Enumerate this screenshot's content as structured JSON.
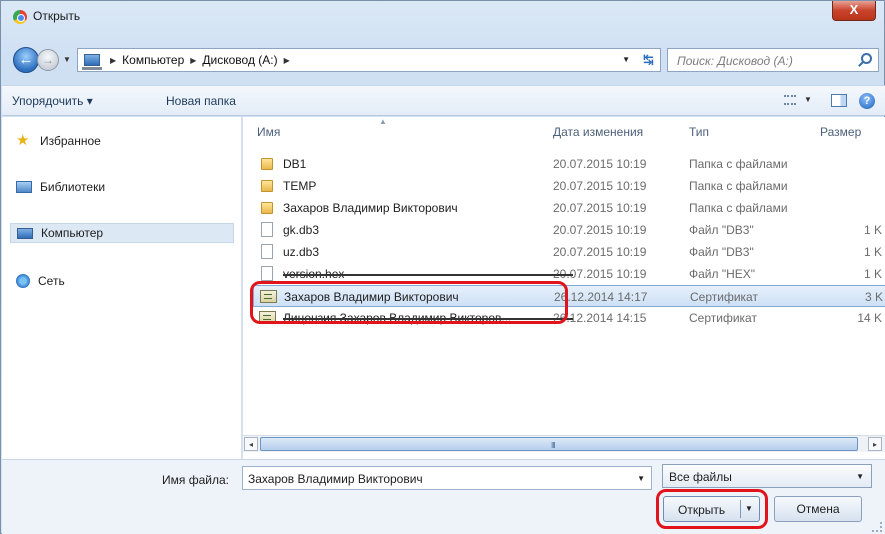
{
  "window": {
    "title": "Открыть",
    "close_glyph": "X"
  },
  "nav": {
    "back_glyph": "←",
    "forward_glyph": "→",
    "breadcrumbs": [
      "Компьютер",
      "Дисковод (A:)"
    ],
    "search_placeholder": "Поиск: Дисковод (A:)"
  },
  "toolbar": {
    "organize": "Упорядочить ▾",
    "new_folder": "Новая папка"
  },
  "sidebar": {
    "items": [
      {
        "label": "Избранное",
        "icon": "star-icon"
      },
      {
        "label": "Библиотеки",
        "icon": "library-icon"
      },
      {
        "label": "Компьютер",
        "icon": "computer-icon",
        "selected": true
      },
      {
        "label": "Сеть",
        "icon": "network-icon"
      }
    ]
  },
  "columns": {
    "name": "Имя",
    "date": "Дата изменения",
    "type": "Тип",
    "size": "Размер"
  },
  "files": [
    {
      "name": "DB1",
      "date": "20.07.2015 10:19",
      "type": "Папка с файлами",
      "size": "",
      "kind": "folder"
    },
    {
      "name": "TEMP",
      "date": "20.07.2015 10:19",
      "type": "Папка с файлами",
      "size": "",
      "kind": "folder"
    },
    {
      "name": "Захаров Владимир Викторович",
      "date": "20.07.2015 10:19",
      "type": "Папка с файлами",
      "size": "",
      "kind": "folder"
    },
    {
      "name": "gk.db3",
      "date": "20.07.2015 10:19",
      "type": "Файл \"DB3\"",
      "size": "1 K",
      "kind": "file"
    },
    {
      "name": "uz.db3",
      "date": "20.07.2015 10:19",
      "type": "Файл \"DB3\"",
      "size": "1 K",
      "kind": "file"
    },
    {
      "name": "version.hex",
      "date": "20.07.2015 10:19",
      "type": "Файл \"HEX\"",
      "size": "1 K",
      "kind": "file"
    },
    {
      "name": "Захаров Владимир Викторович",
      "date": "26.12.2014 14:17",
      "type": "Сертификат",
      "size": "3 K",
      "kind": "cert",
      "selected": true
    },
    {
      "name": "Лицензия Захаров Владимир Викторов...",
      "date": "26.12.2014 14:15",
      "type": "Сертификат",
      "size": "14 K",
      "kind": "cert"
    }
  ],
  "scrollbar": {
    "grip": "III",
    "left_glyph": "◂",
    "right_glyph": "▸"
  },
  "footer": {
    "filename_label": "Имя файла:",
    "filename_value": "Захаров Владимир Викторович",
    "filter_value": "Все файлы",
    "open_label": "Открыть",
    "cancel_label": "Отмена"
  },
  "colors": {
    "accent": "#2d6fbf",
    "highlight": "#e2141b",
    "selection": "#cde0f5"
  }
}
